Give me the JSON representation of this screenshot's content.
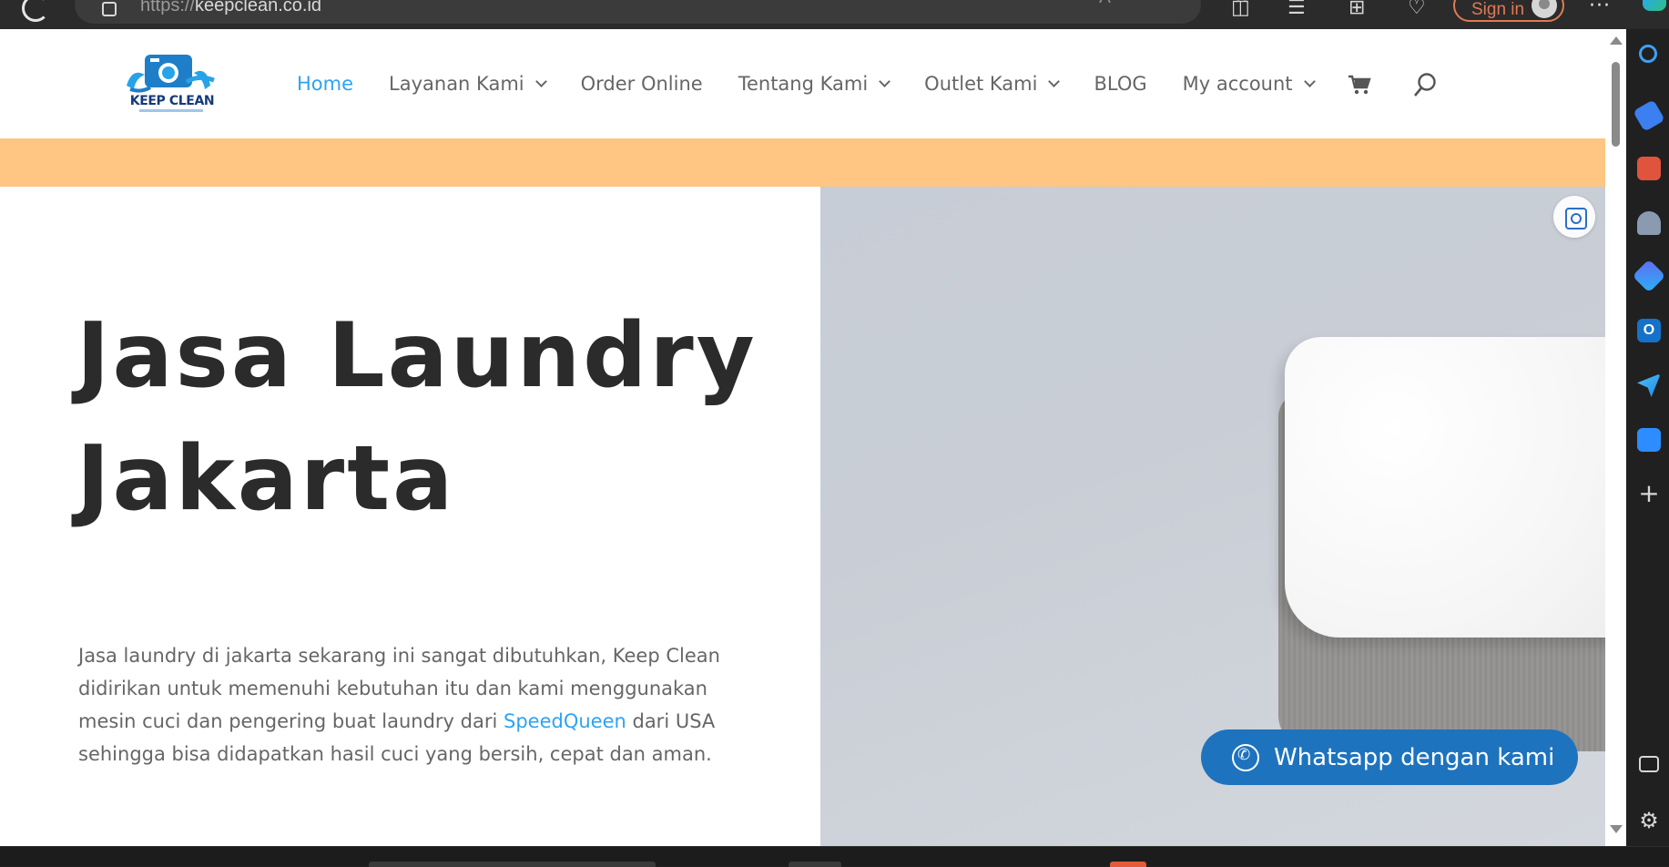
{
  "browser": {
    "url_prefix": "https://",
    "url_host": "keepclean.co.id",
    "signin_label": "Sign in",
    "more_label": "···"
  },
  "site": {
    "logo_text": "KEEP CLEAN",
    "nav": [
      {
        "label": "Home",
        "active": true,
        "has_dropdown": false
      },
      {
        "label": "Layanan Kami",
        "active": false,
        "has_dropdown": true
      },
      {
        "label": "Order Online",
        "active": false,
        "has_dropdown": false
      },
      {
        "label": "Tentang Kami",
        "active": false,
        "has_dropdown": true
      },
      {
        "label": "Outlet Kami",
        "active": false,
        "has_dropdown": true
      },
      {
        "label": "BLOG",
        "active": false,
        "has_dropdown": false
      },
      {
        "label": "My account",
        "active": false,
        "has_dropdown": true
      }
    ],
    "icons": [
      "cart-icon",
      "search-icon"
    ],
    "colors": {
      "accent": "#2ea3f2",
      "band": "#fec682",
      "whatsapp_button": "#1e73be"
    }
  },
  "hero": {
    "title_line1": "Jasa Laundry",
    "title_line2": "Jakarta",
    "text_before_link": "Jasa laundry di jakarta sekarang ini sangat dibutuhkan, Keep Clean didirikan untuk memenuhi kebutuhan itu dan kami menggunakan mesin cuci dan pengering buat laundry dari ",
    "link_text": "SpeedQueen",
    "text_after_link": " dari USA sehingga bisa didapatkan  hasil cuci yang bersih, cepat dan aman."
  },
  "whatsapp": {
    "label": "Whatsapp dengan kami"
  },
  "sidebar": {
    "plus_label": "+",
    "outlook_letter": "O",
    "settings_label": "⚙"
  }
}
